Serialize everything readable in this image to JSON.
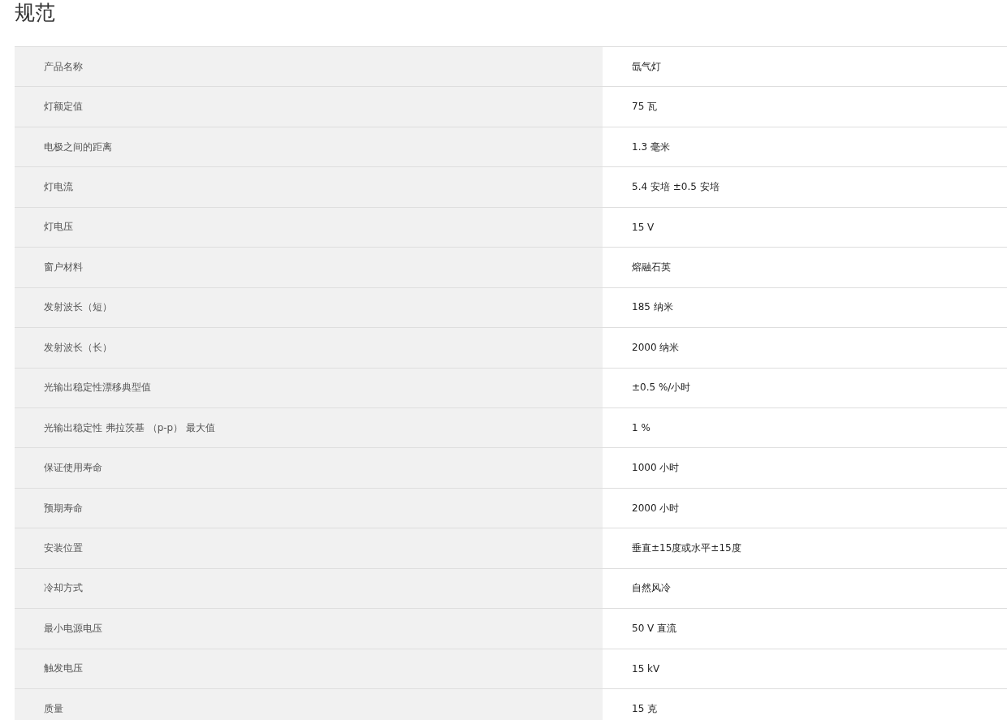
{
  "title": "规范",
  "specs": [
    {
      "label": "产品名称",
      "value": "氙气灯"
    },
    {
      "label": "灯额定值",
      "value": "75 瓦"
    },
    {
      "label": "电极之间的距离",
      "value": "1.3 毫米"
    },
    {
      "label": "灯电流",
      "value": "5.4 安培 ±0.5 安培"
    },
    {
      "label": "灯电压",
      "value": "15 V"
    },
    {
      "label": "窗户材料",
      "value": "熔融石英"
    },
    {
      "label": "发射波长（短）",
      "value": "185 纳米"
    },
    {
      "label": "发射波长（长）",
      "value": "2000 纳米"
    },
    {
      "label": "光输出稳定性漂移典型值",
      "value": "±0.5 %/小时"
    },
    {
      "label": "光输出稳定性 弗拉茨基 （p-p） 最大值",
      "value": "1 %"
    },
    {
      "label": "保证使用寿命",
      "value": "1000 小时"
    },
    {
      "label": "预期寿命",
      "value": "2000 小时"
    },
    {
      "label": "安装位置",
      "value": "垂直±15度或水平±15度"
    },
    {
      "label": "冷却方式",
      "value": "自然风冷"
    },
    {
      "label": "最小电源电压",
      "value": "50 V 直流"
    },
    {
      "label": "触发电压",
      "value": "15 kV"
    },
    {
      "label": "质量",
      "value": "15 克"
    }
  ]
}
